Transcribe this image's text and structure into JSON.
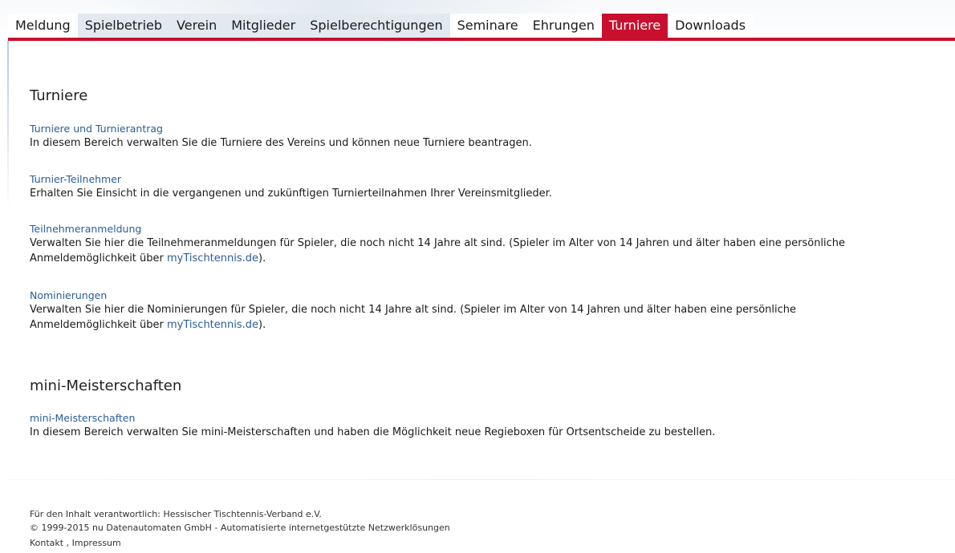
{
  "nav": {
    "items": [
      {
        "label": "Meldung"
      },
      {
        "label": "Spielbetrieb"
      },
      {
        "label": "Verein"
      },
      {
        "label": "Mitglieder"
      },
      {
        "label": "Spielberechtigungen"
      },
      {
        "label": "Seminare"
      },
      {
        "label": "Ehrungen"
      },
      {
        "label": "Turniere"
      },
      {
        "label": "Downloads"
      }
    ],
    "active_index": 7,
    "accent_color": "#c8102e"
  },
  "sections": [
    {
      "heading": "Turniere",
      "entries": [
        {
          "link": "Turniere und Turnierantrag",
          "lines": [
            "In diesem Bereich verwalten Sie die Turniere des Vereins und können neue Turniere beantragen."
          ]
        },
        {
          "link": "Turnier-Teilnehmer",
          "lines": [
            "Erhalten Sie Einsicht in die vergangenen und zukünftigen Turnierteilnahmen Ihrer Vereinsmitglieder."
          ]
        },
        {
          "link": "Teilnehmeranmeldung",
          "line1": "Verwalten Sie hier die Teilnehmeranmeldungen für Spieler, die noch nicht 14 Jahre alt sind. (Spieler im Alter von 14 Jahren und älter haben eine persönliche",
          "line2_prefix": "Anmeldemöglichkeit über ",
          "line2_link": "myTischtennis.de",
          "line2_suffix": ")."
        },
        {
          "link": "Nominierungen",
          "line1": "Verwalten Sie hier die Nominierungen für Spieler, die noch nicht 14 Jahre alt sind. (Spieler im Alter von 14 Jahren und älter haben eine persönliche",
          "line2_prefix": "Anmeldemöglichkeit über ",
          "line2_link": "myTischtennis.de",
          "line2_suffix": ")."
        }
      ]
    },
    {
      "heading": "mini-Meisterschaften",
      "entries": [
        {
          "link": "mini-Meisterschaften",
          "lines": [
            "In diesem Bereich verwalten Sie mini-Meisterschaften und haben die Möglichkeit neue Regieboxen für Ortsentscheide zu bestellen."
          ]
        }
      ]
    }
  ],
  "footer": {
    "responsible": "Für den Inhalt verantwortlich: Hessischer Tischtennis-Verband e.V.",
    "copyright": "© 1999-2015  nu Datenautomaten GmbH - Automatisierte internetgestützte Netzwerklösungen",
    "kontakt": "Kontakt",
    "separator": " , ",
    "impressum": "Impressum"
  },
  "colors": {
    "link": "#2a5d98",
    "nav_light_bg": "#e3e9f1"
  }
}
